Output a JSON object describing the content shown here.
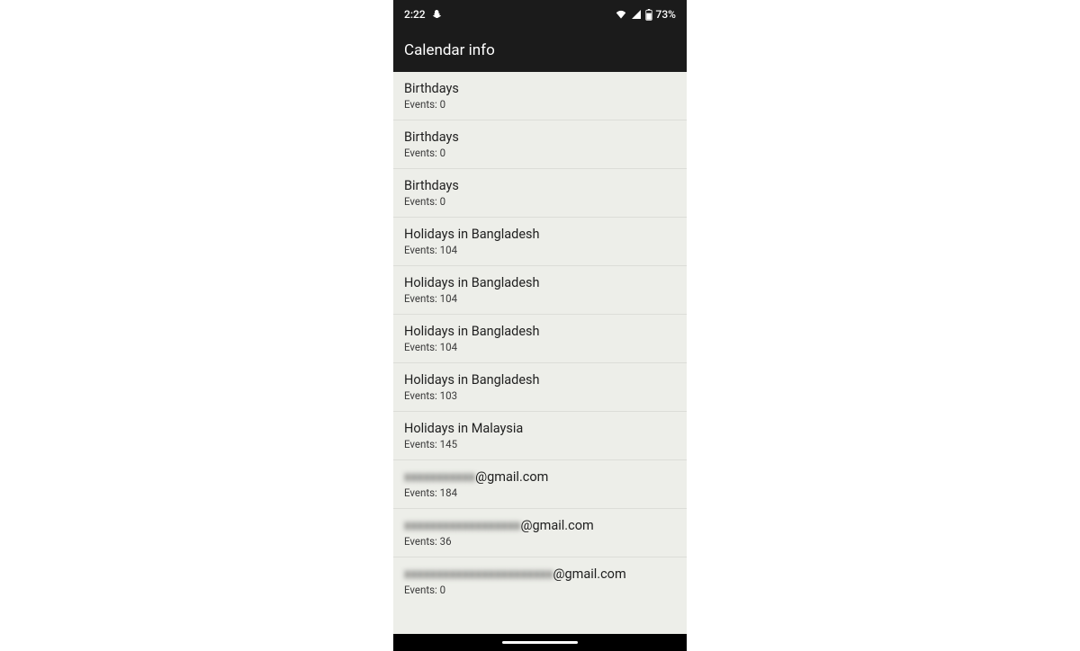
{
  "status": {
    "time": "2:22",
    "battery": "73%"
  },
  "appbar": {
    "title": "Calendar info"
  },
  "list": {
    "items": [
      {
        "title": "Birthdays",
        "sub": "Events: 0",
        "blurPrefix": ""
      },
      {
        "title": "Birthdays",
        "sub": "Events: 0",
        "blurPrefix": ""
      },
      {
        "title": "Birthdays",
        "sub": "Events: 0",
        "blurPrefix": ""
      },
      {
        "title": "Holidays in Bangladesh",
        "sub": "Events: 104",
        "blurPrefix": ""
      },
      {
        "title": "Holidays in Bangladesh",
        "sub": "Events: 104",
        "blurPrefix": ""
      },
      {
        "title": "Holidays in Bangladesh",
        "sub": "Events: 104",
        "blurPrefix": ""
      },
      {
        "title": "Holidays in Bangladesh",
        "sub": "Events: 103",
        "blurPrefix": ""
      },
      {
        "title": "Holidays in Malaysia",
        "sub": "Events: 145",
        "blurPrefix": ""
      },
      {
        "title": "@gmail.com",
        "sub": "Events: 184",
        "blurPrefix": "xxxxxxxxxxx"
      },
      {
        "title": "@gmail.com",
        "sub": "Events: 36",
        "blurPrefix": "xxxxxxxxxxxxxxxxxx"
      },
      {
        "title": "@gmail.com",
        "sub": "Events: 0",
        "blurPrefix": "xxxxxxxxxxxxxxxxxxxxxxx"
      }
    ]
  }
}
